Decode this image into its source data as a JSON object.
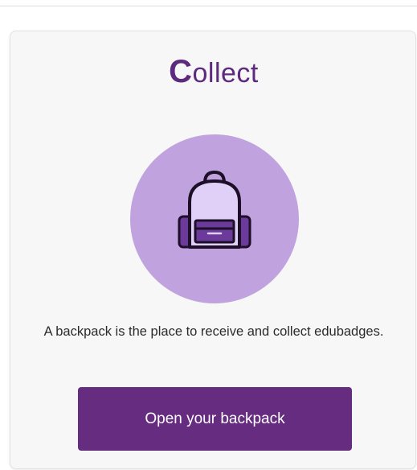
{
  "card": {
    "title_initial": "C",
    "title_rest": "ollect",
    "illustration_icon": "backpack-icon",
    "description": "A backpack is the place to receive and collect edubadges.",
    "button_label": "Open your backpack"
  },
  "colors": {
    "brand_purple": "#652c80",
    "title_purple": "#5e2a7e",
    "circle_lilac": "#c0a3de",
    "backpack_fill": "#e0d0f7",
    "pocket_fill": "#6b3a9a"
  }
}
